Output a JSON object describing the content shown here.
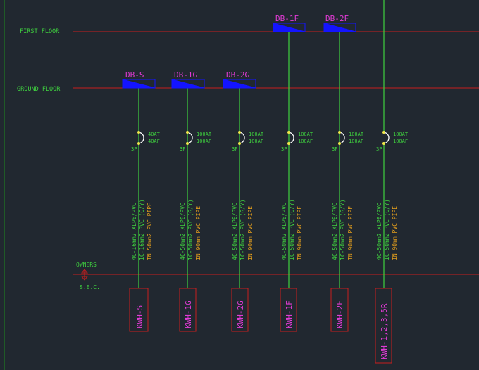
{
  "levels": {
    "first_floor": "FIRST FLOOR",
    "ground_floor": "GROUND FLOOR"
  },
  "owners": {
    "line1": "OWNERS",
    "line2": "S.E.C."
  },
  "boards": [
    {
      "name": "DB-S",
      "breaker_at": "40AT",
      "breaker_af": "40AF",
      "poles": "3P",
      "cable_1": "4C-16mm2 XLPE/PVC",
      "cable_2": "1C-16mm2 PVC (G/Y)",
      "cable_3": "IN 50mm2 PVC PIPE",
      "meter": "KWH-S"
    },
    {
      "name": "DB-1G",
      "breaker_at": "100AT",
      "breaker_af": "100AF",
      "poles": "3P",
      "cable_1": "4C-50mm2 XLPE/PVC",
      "cable_2": "1C-50mm2 PVC (G/Y)",
      "cable_3": "IN 90mm PVC PIPE",
      "meter": "KWH-1G"
    },
    {
      "name": "DB-2G",
      "breaker_at": "100AT",
      "breaker_af": "100AF",
      "poles": "3P",
      "cable_1": "4C-50mm2 XLPE/PVC",
      "cable_2": "1C-50mm2 PVC (G/Y)",
      "cable_3": "IN 90mm PVC PIPE",
      "meter": "KWH-2G"
    },
    {
      "name": "DB-1F",
      "breaker_at": "100AT",
      "breaker_af": "100AF",
      "poles": "3P",
      "cable_1": "4C-50mm2 XLPE/PVC",
      "cable_2": "1C-50mm2 PVC (G/Y)",
      "cable_3": "IN 90mm PVC PIPE",
      "meter": "KWH-1F"
    },
    {
      "name": "DB-2F",
      "breaker_at": "100AT",
      "breaker_af": "100AF",
      "poles": "3P",
      "cable_1": "4C-50mm2 XLPE/PVC",
      "cable_2": "1C-50mm2 PVC (G/Y)",
      "cable_3": "IN 90mm PVC PIPE",
      "meter": "KWH-2F"
    },
    {
      "name": "",
      "breaker_at": "100AT",
      "breaker_af": "100AF",
      "poles": "3P",
      "cable_1": "4C-50mm2 XLPE/PVC",
      "cable_2": "1C-50mm2 PVC (G/Y)",
      "cable_3": "IN 90mm PVC PIPE",
      "meter": "KWH-1,2,3,5R"
    }
  ],
  "colors": {
    "background": "#212830",
    "floor_line": "#c81e1e",
    "text_green": "#3fd23f",
    "text_magenta": "#e23bd6",
    "text_orange": "#e6a01c",
    "board_fill": "#1414ff",
    "breaker_yellow": "#f0e64a",
    "border_green": "#1e8c1e"
  }
}
